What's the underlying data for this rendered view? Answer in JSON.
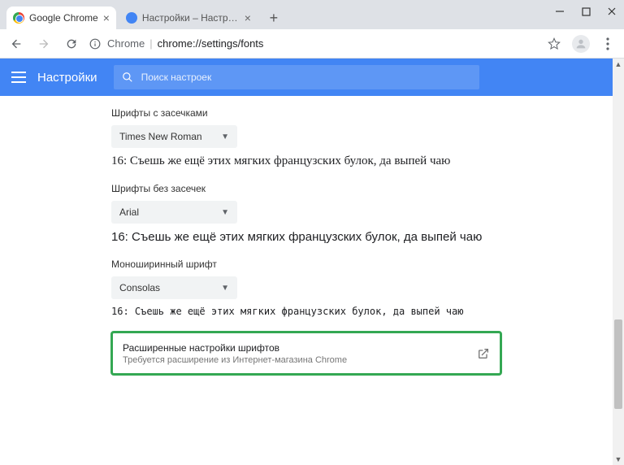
{
  "window": {
    "tabs": [
      {
        "title": "Google Chrome",
        "active": true
      },
      {
        "title": "Настройки – Настроить шрифт...",
        "active": false
      }
    ]
  },
  "toolbar": {
    "chrome_label": "Chrome",
    "url": "chrome://settings/fonts"
  },
  "header": {
    "title": "Настройки",
    "search_placeholder": "Поиск настроек"
  },
  "sections": {
    "serif": {
      "label": "Шрифты с засечками",
      "value": "Times New Roman",
      "sample": "16: Съешь же ещё этих мягких французских булок, да выпей чаю"
    },
    "sans": {
      "label": "Шрифты без засечек",
      "value": "Arial",
      "sample": "16: Съешь же ещё этих мягких французских булок, да выпей чаю"
    },
    "mono": {
      "label": "Моноширинный шрифт",
      "value": "Consolas",
      "sample": "16: Съешь же ещё этих мягких французских булок, да выпей чаю"
    }
  },
  "extension": {
    "title": "Расширенные настройки шрифтов",
    "sub": "Требуется расширение из Интернет-магазина Chrome"
  }
}
